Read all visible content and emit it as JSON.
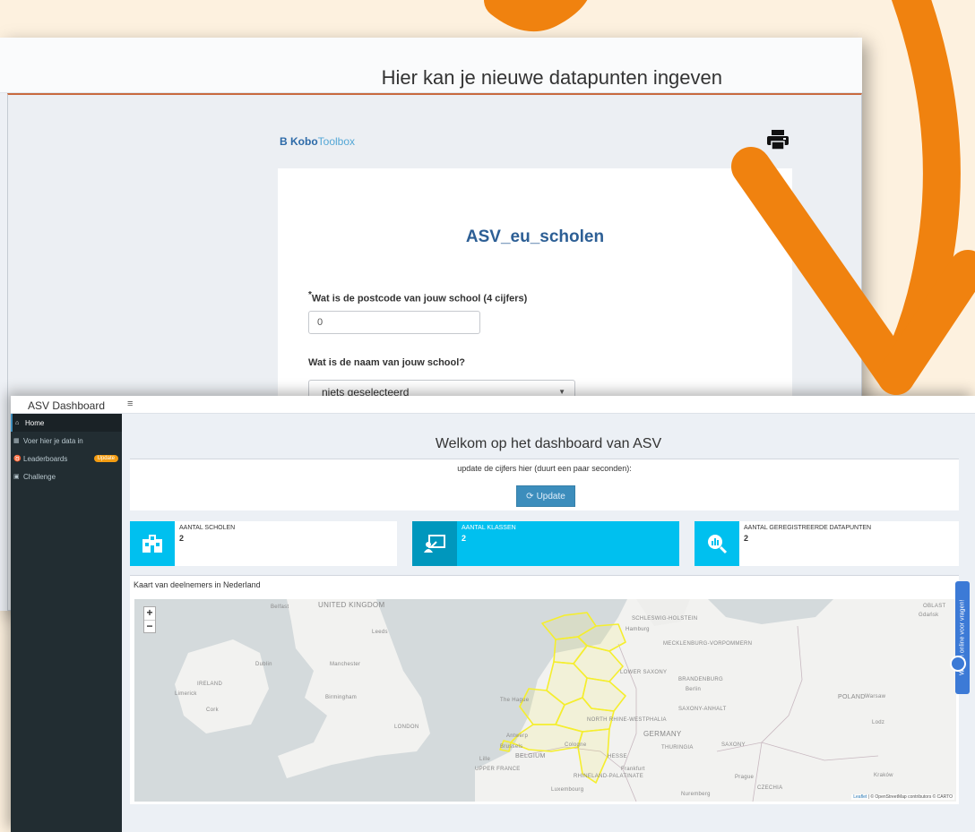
{
  "form_window": {
    "banner_title": "Hier kan je nieuwe datapunten ingeven",
    "kobo": {
      "logo_b": "B",
      "logo_kobo": "Kobo",
      "logo_toolbox": "Toolbox"
    },
    "form_title": "ASV_eu_scholen",
    "questions": [
      {
        "label": "Wat is de postcode van jouw school (4 cijfers)",
        "required_mark": "*",
        "value": "0"
      },
      {
        "label": "Wat is de naam van jouw school?",
        "value": "niets geselecteerd"
      }
    ]
  },
  "dashboard": {
    "brand": "ASV Dashboard",
    "hamburger": "≡",
    "sidebar": [
      {
        "label": "Home",
        "icon": "home-icon"
      },
      {
        "label": "Voer hier je data in",
        "icon": "table-icon"
      },
      {
        "label": "Leaderboards",
        "icon": "trophy-icon",
        "badge": "Update"
      },
      {
        "label": "Challenge",
        "icon": "chart-icon"
      }
    ],
    "title": "Welkom op het dashboard van ASV",
    "update_text": "update de cijfers hier (duurt een paar seconden):",
    "update_button": "Update",
    "infoboxes": [
      {
        "label": "AANTAL SCHOLEN",
        "value": "2",
        "icon": "school-icon",
        "color": "#00c0ef"
      },
      {
        "label": "AANTAL KLASSEN",
        "value": "2",
        "icon": "classroom-icon",
        "color": "#00c0ef"
      },
      {
        "label": "AANTAL GEREGISTREERDE DATAPUNTEN",
        "value": "2",
        "icon": "search-chart-icon",
        "color": "#00c0ef"
      }
    ],
    "map": {
      "title": "Kaart van deelnemers in Nederland",
      "zoom_in": "+",
      "zoom_out": "−",
      "attribution_leaflet": "Leaflet",
      "attribution_rest": " | © OpenStreetMap contributors © CARTO",
      "labels": [
        "UNITED KINGDOM",
        "IRELAND",
        "LONDON",
        "BELGIUM",
        "NORTH RHINE-WESTPHALIA",
        "LOWER SAXONY",
        "SCHLESWIG-HOLSTEIN",
        "MECKLENBURG-VORPOMMERN",
        "BRANDENBURG",
        "SAXONY-ANHALT",
        "GERMANY",
        "THURINGIA",
        "SAXONY",
        "HESSE",
        "POLAND",
        "RHINELAND-PALATINATE",
        "UPPER FRANCE",
        "CZECHIA",
        "OBLAST",
        "Berlin",
        "Hamburg",
        "Manchester",
        "Dublin",
        "Leeds",
        "Birmingham",
        "Cork",
        "Limerick",
        "Belfast",
        "Brussels",
        "Cologne",
        "Frankfurt",
        "Prague",
        "Warsaw",
        "Lodz",
        "Kraków",
        "Nuremberg",
        "Luxembourg",
        "Lille",
        "Gdańsk",
        "The Hague",
        "Antwerp"
      ]
    },
    "chat_tab": "We zijn online voor vragen!"
  },
  "colors": {
    "accent_orange": "#f0820f",
    "primary": "#3c8dbc",
    "info_cyan": "#00c0ef",
    "sidebar": "#222d32",
    "map_yellow": "#f5ee2e",
    "badge": "#f39c12"
  }
}
